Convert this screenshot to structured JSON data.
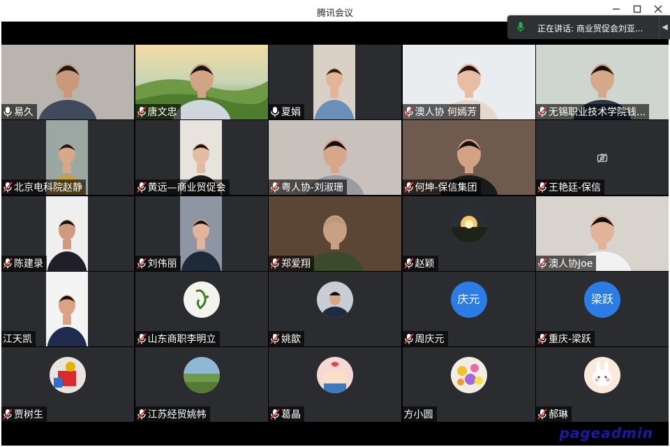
{
  "window": {
    "title": "腾讯会议"
  },
  "speaking": {
    "text": "正在讲话: 商业贸促会刘亚..."
  },
  "participants": [
    {
      "name": "易久",
      "mic": true
    },
    {
      "name": "唐文忠",
      "mic": "muted"
    },
    {
      "name": "夏娟",
      "mic": true
    },
    {
      "name": "澳人协 何嫣芳",
      "mic": "muted"
    },
    {
      "name": "无锡职业技术学院钱...",
      "mic": "muted"
    },
    {
      "name": "北京电科院赵静",
      "mic": "muted"
    },
    {
      "name": "黄远—商业贸促会",
      "mic": "muted"
    },
    {
      "name": "粤人协-刘淑珊",
      "mic": "muted"
    },
    {
      "name": "何坤-保信集团",
      "mic": "muted"
    },
    {
      "name": "王艳廷-保信",
      "mic": "muted"
    },
    {
      "name": "陈建录",
      "mic": "muted"
    },
    {
      "name": "刘伟丽",
      "mic": "muted"
    },
    {
      "name": "郑爱翔",
      "mic": "muted"
    },
    {
      "name": "赵颖",
      "mic": "muted"
    },
    {
      "name": "澳人协Joe",
      "mic": "muted"
    },
    {
      "name": "江天凯",
      "mic": false
    },
    {
      "name": "山东商职李明立",
      "mic": "muted"
    },
    {
      "name": "姚歆",
      "mic": "muted"
    },
    {
      "name": "周庆元",
      "mic": "muted",
      "avatar_text": "庆元"
    },
    {
      "name": "重庆-梁跃",
      "mic": "muted",
      "avatar_text": "梁跃"
    },
    {
      "name": "贾树生",
      "mic": "muted"
    },
    {
      "name": "江苏经贸姚帏",
      "mic": "muted"
    },
    {
      "name": "葛晶",
      "mic": "muted"
    },
    {
      "name": "方小圆",
      "mic": false
    },
    {
      "name": "郝琳",
      "mic": "muted"
    }
  ],
  "watermark": "pageadmin",
  "colors": {
    "accent": "#2c7ce6",
    "mic_active": "#1fb84a",
    "mic_muted": "#e53935",
    "tile_bg": "#2b2c2f"
  }
}
